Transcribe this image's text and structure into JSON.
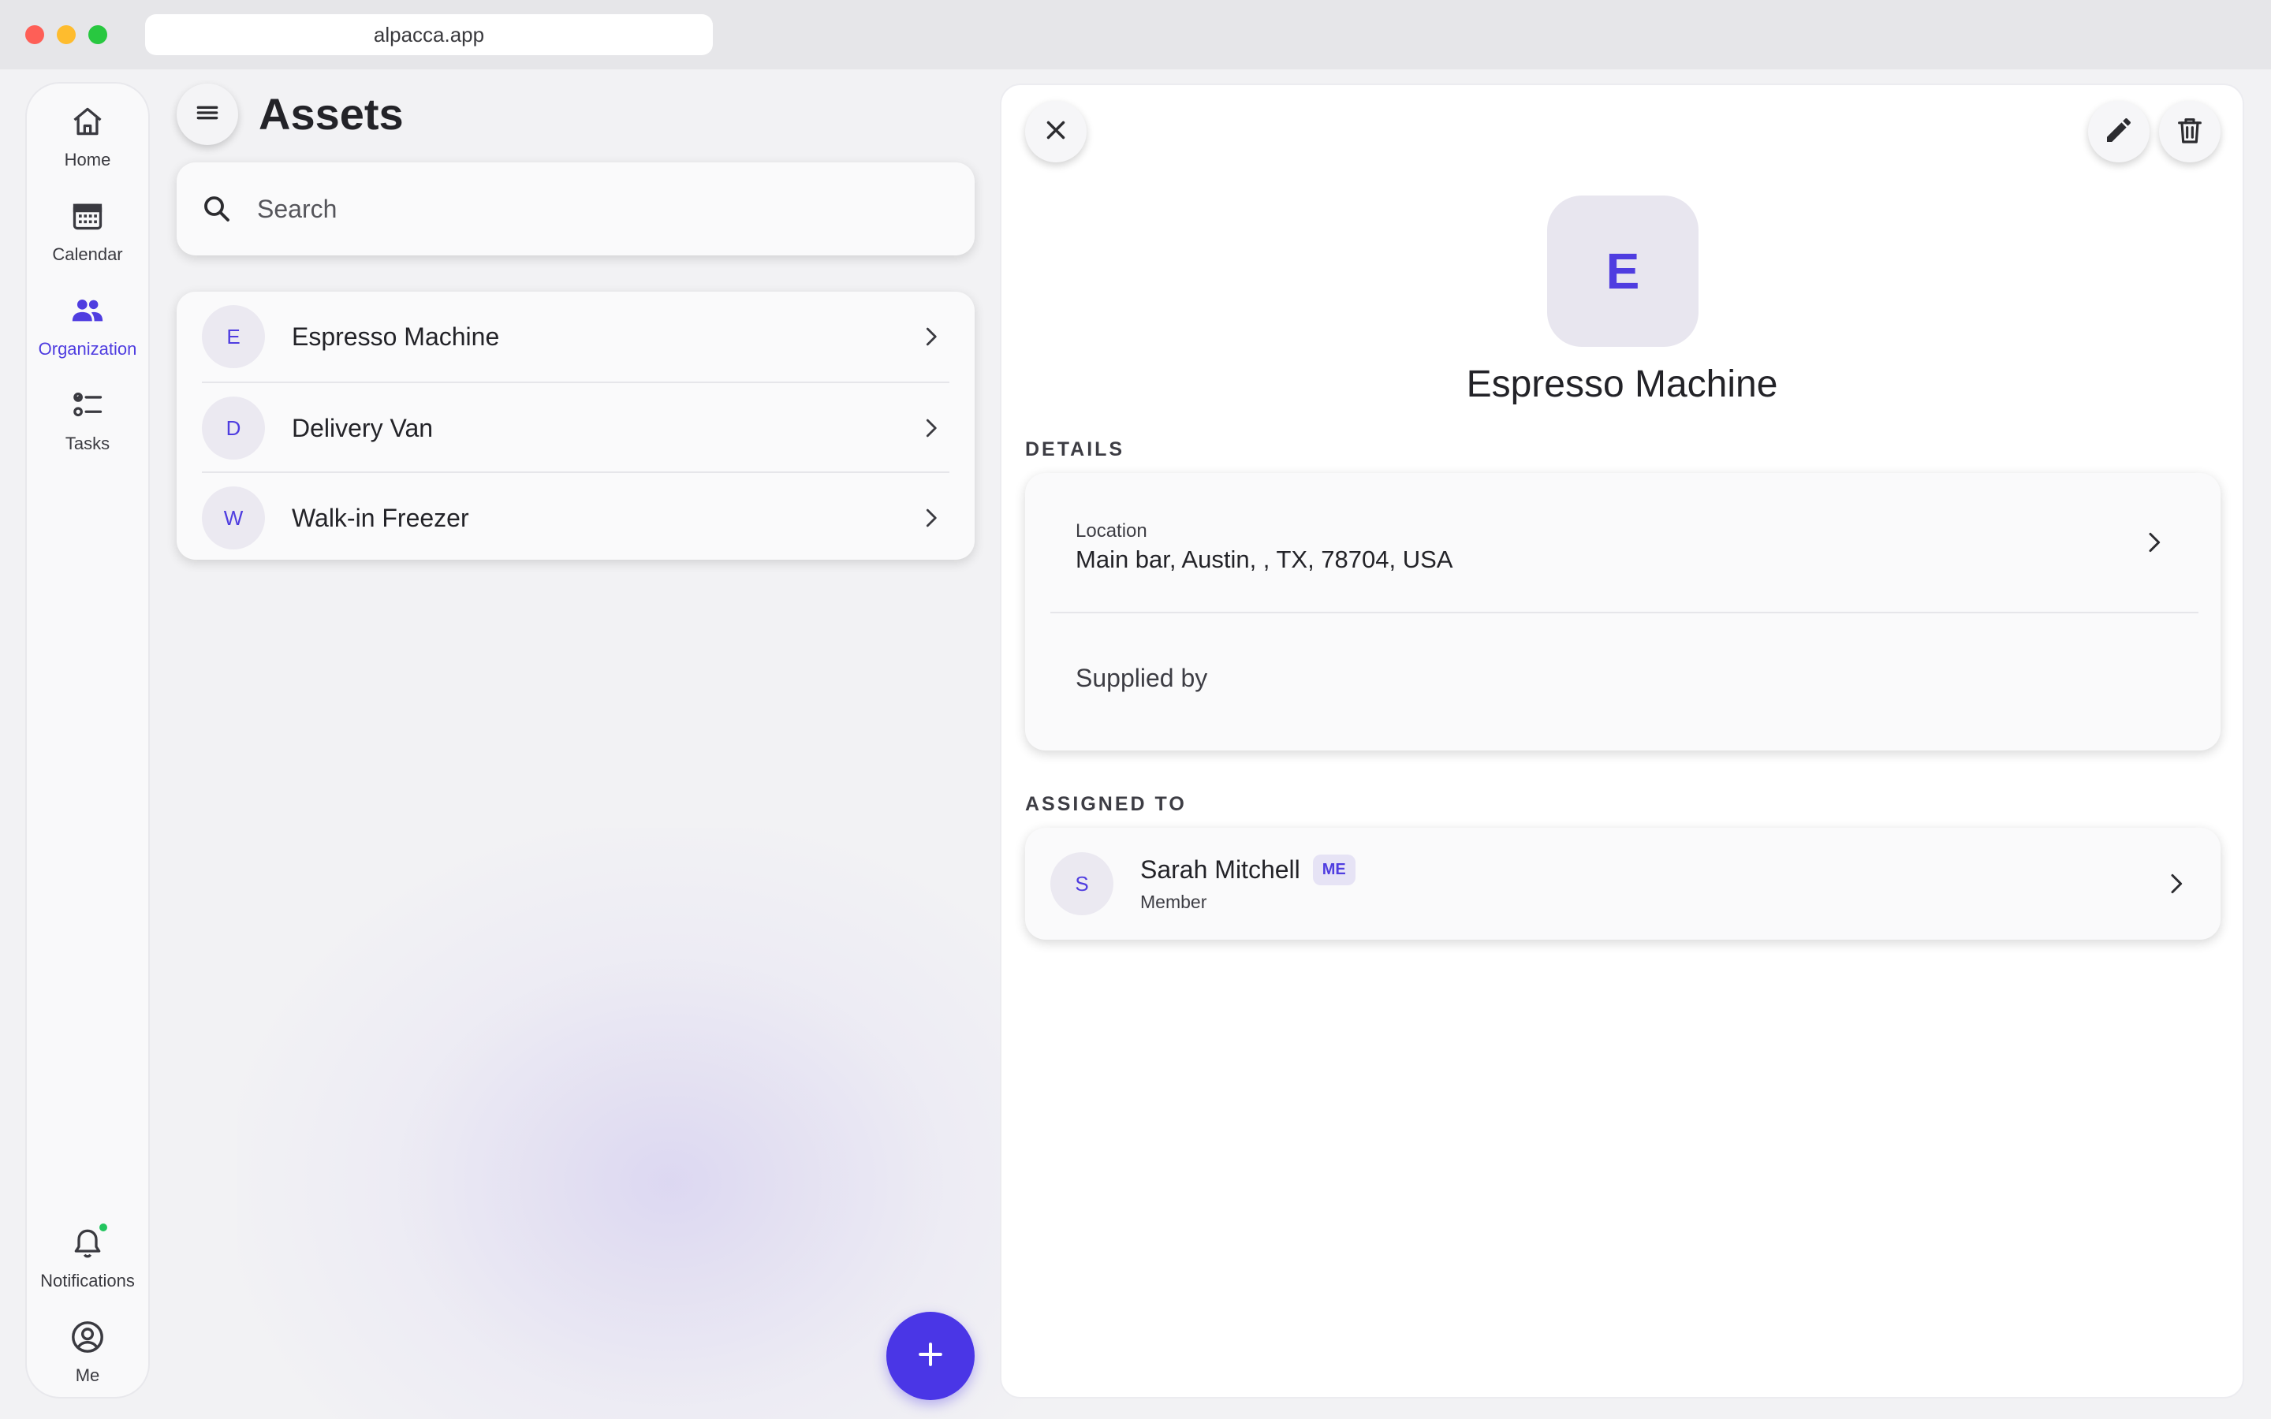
{
  "browser": {
    "url": "alpacca.app"
  },
  "rail": {
    "items": [
      {
        "label": "Home",
        "icon": "home-icon"
      },
      {
        "label": "Calendar",
        "icon": "calendar-icon"
      },
      {
        "label": "Organization",
        "icon": "people-icon",
        "active": true
      },
      {
        "label": "Tasks",
        "icon": "tasks-icon"
      }
    ],
    "bottom_items": [
      {
        "label": "Notifications",
        "icon": "bell-icon",
        "has_dot": true
      },
      {
        "label": "Me",
        "icon": "user-circle-icon"
      }
    ]
  },
  "assets": {
    "title": "Assets",
    "search_placeholder": "Search",
    "items": [
      {
        "initial": "E",
        "name": "Espresso Machine"
      },
      {
        "initial": "D",
        "name": "Delivery Van"
      },
      {
        "initial": "W",
        "name": "Walk-in Freezer"
      }
    ]
  },
  "detail": {
    "initial": "E",
    "title": "Espresso Machine",
    "details_label": "DETAILS",
    "location_label": "Location",
    "location_value": "Main bar, Austin, , TX, 78704, USA",
    "supplied_label": "Supplied by",
    "assigned_label": "ASSIGNED TO",
    "assignee": {
      "initial": "S",
      "name": "Sarah Mitchell",
      "badge": "ME",
      "role": "Member"
    }
  },
  "colors": {
    "accent": "#4a36e6",
    "avatar_bg": "#ebe9f1",
    "notification_dot": "#22c55e"
  }
}
